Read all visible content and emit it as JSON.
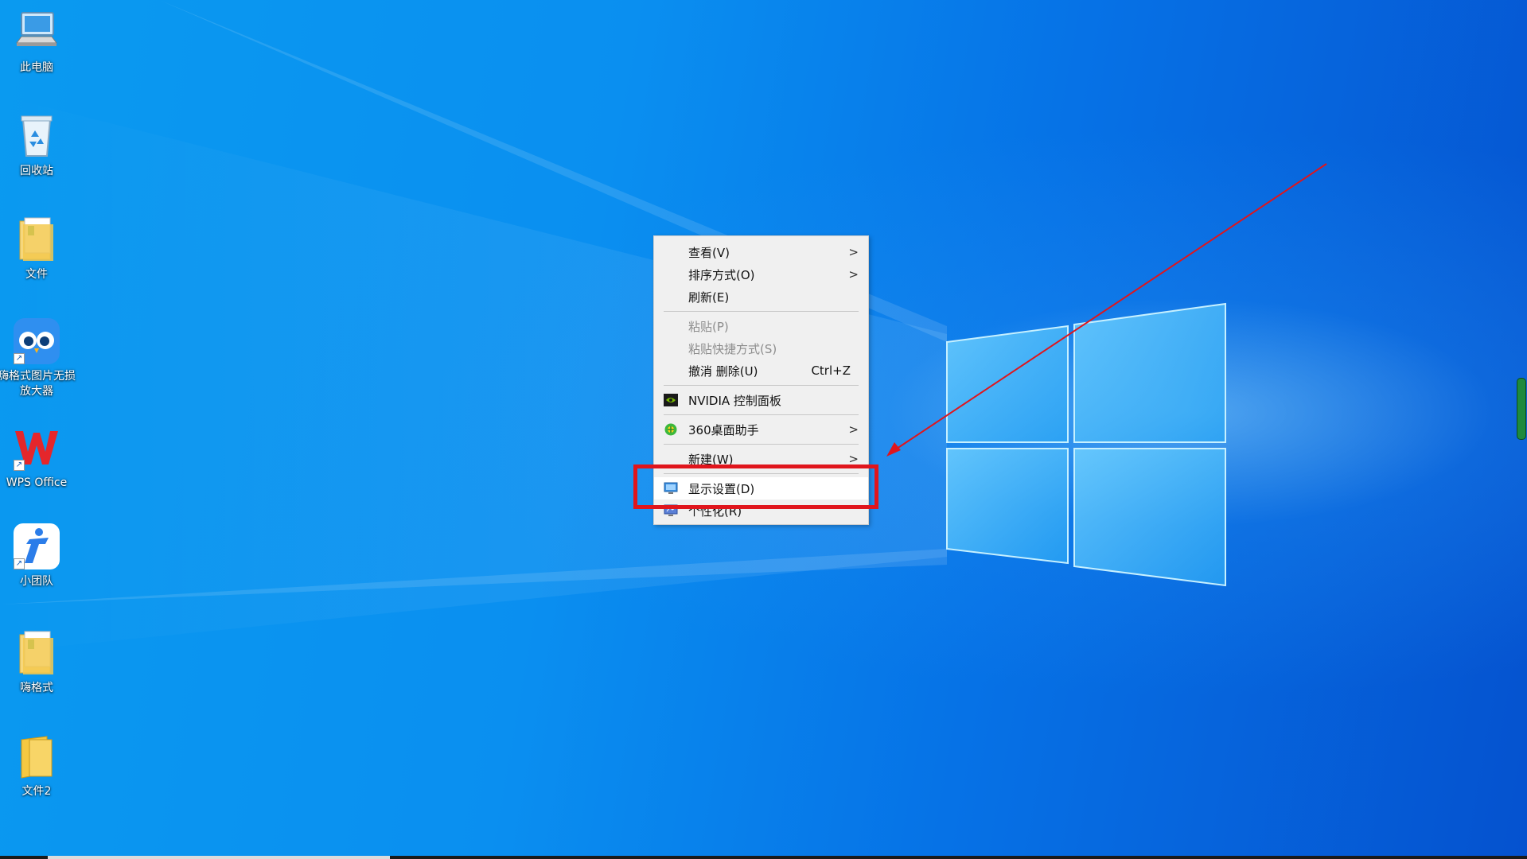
{
  "desktop": {
    "icons": [
      {
        "label": "此电脑",
        "icon": "computer-icon"
      },
      {
        "label": "回收站",
        "icon": "recycle-bin-icon"
      },
      {
        "label": "文件",
        "icon": "folder-icon"
      },
      {
        "label": "嗨格式图片无损放大器",
        "icon": "owl-app-icon"
      },
      {
        "label": "WPS Office",
        "icon": "wps-office-icon"
      },
      {
        "label": "小团队",
        "icon": "team-app-icon"
      },
      {
        "label": "嗨格式",
        "icon": "folder-icon"
      },
      {
        "label": "文件2",
        "icon": "folder-icon"
      }
    ]
  },
  "context_menu": {
    "view": {
      "label": "查看(V)",
      "submenu_arrow": ">"
    },
    "sort": {
      "label": "排序方式(O)",
      "submenu_arrow": ">"
    },
    "refresh": {
      "label": "刷新(E)"
    },
    "paste": {
      "label": "粘贴(P)",
      "disabled": true
    },
    "paste_shortcut": {
      "label": "粘贴快捷方式(S)",
      "disabled": true
    },
    "undo_delete": {
      "label": "撤消 删除(U)",
      "shortcut": "Ctrl+Z"
    },
    "nvidia": {
      "label": "NVIDIA 控制面板",
      "icon": "nvidia-icon"
    },
    "desktop_helper": {
      "label": "360桌面助手",
      "icon": "360-icon",
      "submenu_arrow": ">"
    },
    "new": {
      "label": "新建(W)",
      "submenu_arrow": ">"
    },
    "display_settings": {
      "label": "显示设置(D)",
      "icon": "display-icon",
      "highlighted": true
    },
    "personalize": {
      "label": "个性化(R)",
      "icon": "personalize-icon"
    }
  },
  "annotation": {
    "box_color": "#e0151c",
    "arrow_color": "#e0151c"
  },
  "colors": {
    "wallpaper_blue": "#0a78e8",
    "menu_bg": "#f0f0f0"
  }
}
